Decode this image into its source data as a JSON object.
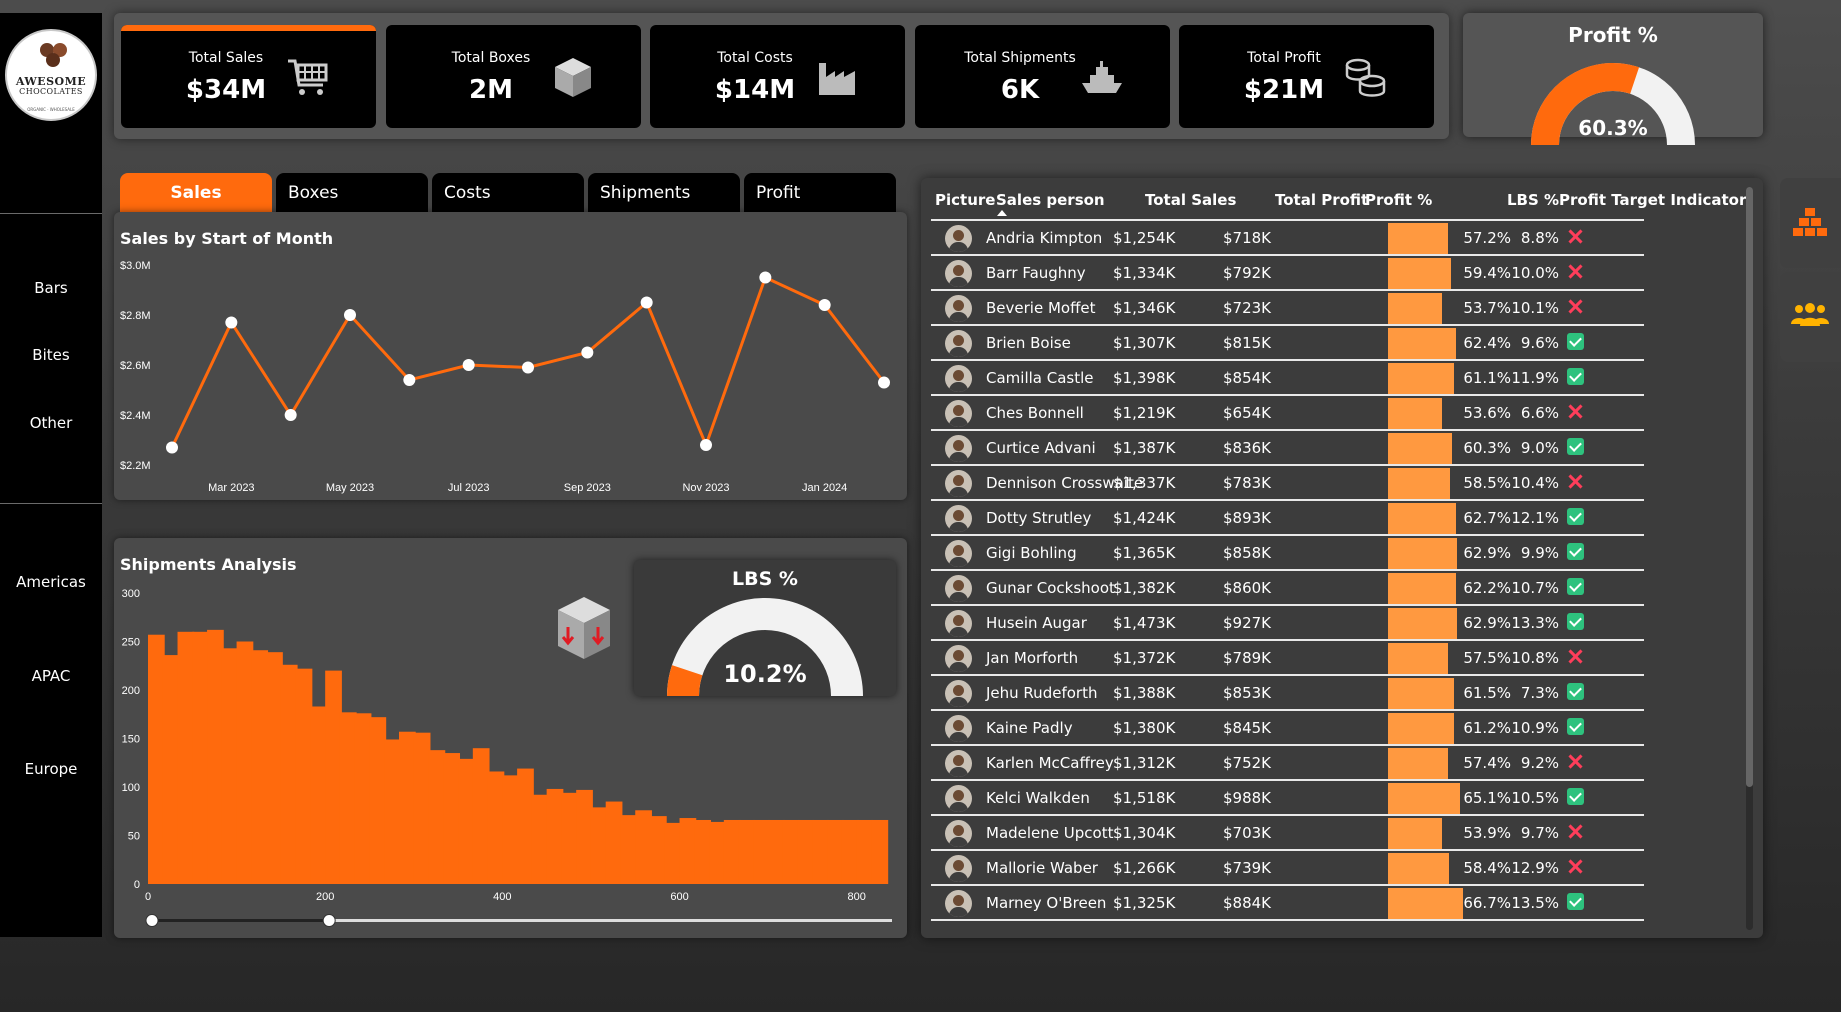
{
  "brand": {
    "name_line1": "AWESOME",
    "name_line2": "CHOCOLATES",
    "tagline": "ORGANIC · WHOLESALE"
  },
  "sidebar": {
    "product_items": [
      "Bars",
      "Bites",
      "Other"
    ],
    "region_items": [
      "Americas",
      "APAC",
      "Europe"
    ]
  },
  "kpis": [
    {
      "label": "Total Sales",
      "value": "$34M",
      "icon": "shopping-cart-icon"
    },
    {
      "label": "Total Boxes",
      "value": "2M",
      "icon": "box-icon"
    },
    {
      "label": "Total Costs",
      "value": "$14M",
      "icon": "factory-icon"
    },
    {
      "label": "Total Shipments",
      "value": "6K",
      "icon": "ship-icon"
    },
    {
      "label": "Total Profit",
      "value": "$21M",
      "icon": "coins-icon"
    }
  ],
  "profit_gauge": {
    "title": "Profit %",
    "value_label": "60.3%",
    "value": 0.603,
    "fill_color": "#ff6a0d",
    "track_color": "#f2f2f2"
  },
  "tabs": [
    "Sales",
    "Boxes",
    "Costs",
    "Shipments",
    "Profit"
  ],
  "active_tab": "Sales",
  "line_panel": {
    "title": "Sales by Start of Month"
  },
  "shipments_panel": {
    "title": "Shipments Analysis"
  },
  "lbs_gauge": {
    "title": "LBS %",
    "value_label": "10.2%",
    "value": 0.102,
    "fill_color": "#ff6a0d",
    "track_color": "#f2f2f2"
  },
  "chart_data": [
    {
      "type": "line",
      "title": "Sales by Start of Month",
      "x": [
        "Feb 2023",
        "Mar 2023",
        "Apr 2023",
        "May 2023",
        "Jun 2023",
        "Jul 2023",
        "Aug 2023",
        "Sep 2023",
        "Oct 2023",
        "Nov 2023",
        "Dec 2023",
        "Jan 2024",
        "Feb 2024"
      ],
      "x_tick_labels": [
        "Mar 2023",
        "May 2023",
        "Jul 2023",
        "Sep 2023",
        "Nov 2023",
        "Jan 2024"
      ],
      "values": [
        2.27,
        2.77,
        2.4,
        2.8,
        2.54,
        2.6,
        2.59,
        2.65,
        2.85,
        2.28,
        2.95,
        2.84,
        2.53
      ],
      "unit": "$M",
      "y_tick_labels": [
        "$2.2M",
        "$2.4M",
        "$2.6M",
        "$2.8M",
        "$3.0M"
      ],
      "ylim": [
        2.2,
        3.0
      ],
      "line_color": "#ff6a0d",
      "grid": false
    },
    {
      "type": "bar",
      "title": "Shipments Analysis",
      "x_tick_labels": [
        "0",
        "200",
        "400",
        "600",
        "800"
      ],
      "xlim": [
        0,
        850
      ],
      "bin_width": 20,
      "values": [
        257,
        236,
        260,
        260,
        262,
        243,
        250,
        241,
        239,
        226,
        222,
        183,
        220,
        177,
        176,
        172,
        149,
        157,
        156,
        138,
        135,
        129,
        140,
        116,
        112,
        119,
        92,
        98,
        94,
        97,
        79,
        85,
        71,
        76,
        70,
        63,
        68,
        66,
        64,
        66,
        66,
        66,
        66,
        66,
        66,
        66,
        66,
        66,
        66,
        66,
        66,
        66
      ],
      "y_tick_labels": [
        "0",
        "50",
        "100",
        "150",
        "200",
        "250",
        "300"
      ],
      "ylim": [
        0,
        300
      ],
      "bar_color": "#ff6a0d",
      "range_slider": {
        "min": 0,
        "max": 200
      }
    }
  ],
  "table": {
    "columns": [
      "Picture",
      "Sales person",
      "Total Sales",
      "Total Profit",
      "Profit %",
      "LBS %",
      "Profit Target Indicator"
    ],
    "sort_column": "Sales person",
    "sort_icon": "sort-ascending-icon",
    "rows": [
      {
        "name": "Andria Kimpton",
        "sales": "$1,254K",
        "profit": "$718K",
        "profit_pct": "57.2%",
        "profit_pct_value": 0.572,
        "lbs": "8.8%",
        "target_met": false
      },
      {
        "name": "Barr Faughny",
        "sales": "$1,334K",
        "profit": "$792K",
        "profit_pct": "59.4%",
        "profit_pct_value": 0.594,
        "lbs": "10.0%",
        "target_met": false
      },
      {
        "name": "Beverie Moffet",
        "sales": "$1,346K",
        "profit": "$723K",
        "profit_pct": "53.7%",
        "profit_pct_value": 0.537,
        "lbs": "10.1%",
        "target_met": false
      },
      {
        "name": "Brien Boise",
        "sales": "$1,307K",
        "profit": "$815K",
        "profit_pct": "62.4%",
        "profit_pct_value": 0.624,
        "lbs": "9.6%",
        "target_met": true
      },
      {
        "name": "Camilla Castle",
        "sales": "$1,398K",
        "profit": "$854K",
        "profit_pct": "61.1%",
        "profit_pct_value": 0.611,
        "lbs": "11.9%",
        "target_met": true
      },
      {
        "name": "Ches Bonnell",
        "sales": "$1,219K",
        "profit": "$654K",
        "profit_pct": "53.6%",
        "profit_pct_value": 0.536,
        "lbs": "6.6%",
        "target_met": false
      },
      {
        "name": "Curtice Advani",
        "sales": "$1,387K",
        "profit": "$836K",
        "profit_pct": "60.3%",
        "profit_pct_value": 0.603,
        "lbs": "9.0%",
        "target_met": true
      },
      {
        "name": "Dennison Crosswaite",
        "sales": "$1,337K",
        "profit": "$783K",
        "profit_pct": "58.5%",
        "profit_pct_value": 0.585,
        "lbs": "10.4%",
        "target_met": false
      },
      {
        "name": "Dotty Strutley",
        "sales": "$1,424K",
        "profit": "$893K",
        "profit_pct": "62.7%",
        "profit_pct_value": 0.627,
        "lbs": "12.1%",
        "target_met": true
      },
      {
        "name": "Gigi Bohling",
        "sales": "$1,365K",
        "profit": "$858K",
        "profit_pct": "62.9%",
        "profit_pct_value": 0.629,
        "lbs": "9.9%",
        "target_met": true
      },
      {
        "name": "Gunar Cockshoot",
        "sales": "$1,382K",
        "profit": "$860K",
        "profit_pct": "62.2%",
        "profit_pct_value": 0.622,
        "lbs": "10.7%",
        "target_met": true
      },
      {
        "name": "Husein Augar",
        "sales": "$1,473K",
        "profit": "$927K",
        "profit_pct": "62.9%",
        "profit_pct_value": 0.629,
        "lbs": "13.3%",
        "target_met": true
      },
      {
        "name": "Jan Morforth",
        "sales": "$1,372K",
        "profit": "$789K",
        "profit_pct": "57.5%",
        "profit_pct_value": 0.575,
        "lbs": "10.8%",
        "target_met": false
      },
      {
        "name": "Jehu Rudeforth",
        "sales": "$1,388K",
        "profit": "$853K",
        "profit_pct": "61.5%",
        "profit_pct_value": 0.615,
        "lbs": "7.3%",
        "target_met": true
      },
      {
        "name": "Kaine Padly",
        "sales": "$1,380K",
        "profit": "$845K",
        "profit_pct": "61.2%",
        "profit_pct_value": 0.612,
        "lbs": "10.9%",
        "target_met": true
      },
      {
        "name": "Karlen McCaffrey",
        "sales": "$1,312K",
        "profit": "$752K",
        "profit_pct": "57.4%",
        "profit_pct_value": 0.574,
        "lbs": "9.2%",
        "target_met": false
      },
      {
        "name": "Kelci Walkden",
        "sales": "$1,518K",
        "profit": "$988K",
        "profit_pct": "65.1%",
        "profit_pct_value": 0.651,
        "lbs": "10.5%",
        "target_met": true
      },
      {
        "name": "Madelene Upcott",
        "sales": "$1,304K",
        "profit": "$703K",
        "profit_pct": "53.9%",
        "profit_pct_value": 0.539,
        "lbs": "9.7%",
        "target_met": false
      },
      {
        "name": "Mallorie Waber",
        "sales": "$1,266K",
        "profit": "$739K",
        "profit_pct": "58.4%",
        "profit_pct_value": 0.584,
        "lbs": "12.9%",
        "target_met": false
      },
      {
        "name": "Marney O'Breen",
        "sales": "$1,325K",
        "profit": "$884K",
        "profit_pct": "66.7%",
        "profit_pct_value": 0.667,
        "lbs": "13.5%",
        "target_met": true
      }
    ],
    "colors": {
      "bar": "#ff9940",
      "ok": "#2ec27e",
      "fail": "#ff3d5a"
    }
  },
  "right_buttons": [
    {
      "icon": "stacked-bars-icon",
      "color": "#ff6a0d"
    },
    {
      "icon": "people-group-icon",
      "color": "#ffb300"
    }
  ]
}
